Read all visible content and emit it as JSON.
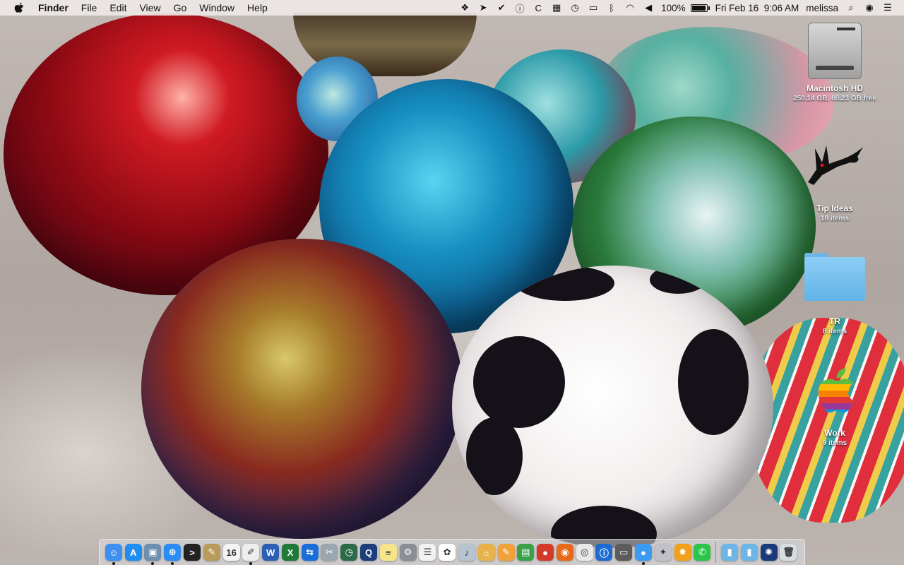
{
  "menubar": {
    "app_name": "Finder",
    "menus": [
      "File",
      "Edit",
      "View",
      "Go",
      "Window",
      "Help"
    ],
    "battery_percent": "100%",
    "battery_level": 1.0,
    "datetime": "Fri Feb 16  9:06 AM",
    "user": "melissa",
    "status_icons": [
      "dropbox-icon",
      "location-arrow-icon",
      "checkmark-circle-icon",
      "info-circle-icon",
      "c-app-icon",
      "calendar-mini-icon",
      "time-machine-icon",
      "airplay-icon",
      "bluetooth-icon",
      "wifi-icon",
      "volume-icon"
    ]
  },
  "desktop": {
    "items": [
      {
        "label": "Macintosh HD",
        "sub": "250.14 GB, 66.23 GB free",
        "icon": "hard-drive-icon"
      },
      {
        "label": "Tip Ideas",
        "sub": "18 items",
        "icon": "rabbit-folder-icon"
      },
      {
        "label": "TR",
        "sub": "8 items",
        "icon": "folder-icon"
      },
      {
        "label": "Work",
        "sub": "9 items",
        "icon": "rainbow-apple-icon"
      }
    ]
  },
  "dock": {
    "apps": [
      {
        "name": "finder-icon",
        "color": "#3d8ff0",
        "glyph": "☺",
        "running": true
      },
      {
        "name": "app-store-icon",
        "color": "#1e8ef0",
        "glyph": "A",
        "running": false
      },
      {
        "name": "preview-icon",
        "color": "#6f8fb0",
        "glyph": "▣",
        "running": true
      },
      {
        "name": "safari-icon",
        "color": "#2b8df2",
        "glyph": "⊕",
        "running": true
      },
      {
        "name": "terminal-icon",
        "color": "#222222",
        "glyph": ">",
        "running": false
      },
      {
        "name": "notefile-icon",
        "color": "#b89a5a",
        "glyph": "✎",
        "running": false
      },
      {
        "name": "calendar-icon",
        "color": "#f4f4f4",
        "glyph": "16",
        "running": false
      },
      {
        "name": "textedit-icon",
        "color": "#eeeeee",
        "glyph": "✐",
        "running": true
      },
      {
        "name": "word-icon",
        "color": "#2b5fb3",
        "glyph": "W",
        "running": false
      },
      {
        "name": "excel-icon",
        "color": "#1f7a3a",
        "glyph": "X",
        "running": false
      },
      {
        "name": "teamviewer-icon",
        "color": "#1a6ed8",
        "glyph": "⇆",
        "running": false
      },
      {
        "name": "image-capture-icon",
        "color": "#9aa7b0",
        "glyph": "✂",
        "running": false
      },
      {
        "name": "time-machine-icon",
        "color": "#2d6a4a",
        "glyph": "◷",
        "running": false
      },
      {
        "name": "quicktime-icon",
        "color": "#1c3f7a",
        "glyph": "Q",
        "running": false
      },
      {
        "name": "notes-icon",
        "color": "#f7e58a",
        "glyph": "≡",
        "running": false
      },
      {
        "name": "system-preferences-icon",
        "color": "#8a8f96",
        "glyph": "⚙",
        "running": false
      },
      {
        "name": "reminders-icon",
        "color": "#f2f2f2",
        "glyph": "☰",
        "running": false
      },
      {
        "name": "photos-icon",
        "color": "#ffffff",
        "glyph": "✿",
        "running": false
      },
      {
        "name": "voice-icon",
        "color": "#b7c3ce",
        "glyph": "♪",
        "running": false
      },
      {
        "name": "ibooks-icon",
        "color": "#e8b24a",
        "glyph": "☼",
        "running": false
      },
      {
        "name": "pages-icon",
        "color": "#f0a23a",
        "glyph": "✎",
        "running": false
      },
      {
        "name": "numbers-icon",
        "color": "#3aa04a",
        "glyph": "▤",
        "running": false
      },
      {
        "name": "fetch-icon",
        "color": "#d33a2a",
        "glyph": "●",
        "running": false
      },
      {
        "name": "firefox-icon",
        "color": "#e66a1a",
        "glyph": "◉",
        "running": false
      },
      {
        "name": "chrome-icon",
        "color": "#e8e8e8",
        "glyph": "◎",
        "running": false
      },
      {
        "name": "1password-icon",
        "color": "#1d6bd0",
        "glyph": "ⓘ",
        "running": false
      },
      {
        "name": "keyboard-icon",
        "color": "#5c5c5c",
        "glyph": "▭",
        "running": false
      },
      {
        "name": "messages-icon",
        "color": "#3a9cf0",
        "glyph": "●",
        "running": true
      },
      {
        "name": "automator-icon",
        "color": "#c0c0c8",
        "glyph": "✦",
        "running": false
      },
      {
        "name": "snagit-icon",
        "color": "#f2a01a",
        "glyph": "✸",
        "running": false
      },
      {
        "name": "whatsapp-icon",
        "color": "#2dc44a",
        "glyph": "✆",
        "running": false
      }
    ],
    "stack_items": [
      {
        "name": "applications-folder-icon",
        "color": "#6cb5e6",
        "glyph": "▮"
      },
      {
        "name": "documents-folder-icon",
        "color": "#6cb5e6",
        "glyph": "▮"
      },
      {
        "name": "recent-image-icon",
        "color": "#1a3a7a",
        "glyph": "✺"
      },
      {
        "name": "trash-icon",
        "color": "#d8dde3",
        "glyph": "🗑"
      }
    ]
  }
}
